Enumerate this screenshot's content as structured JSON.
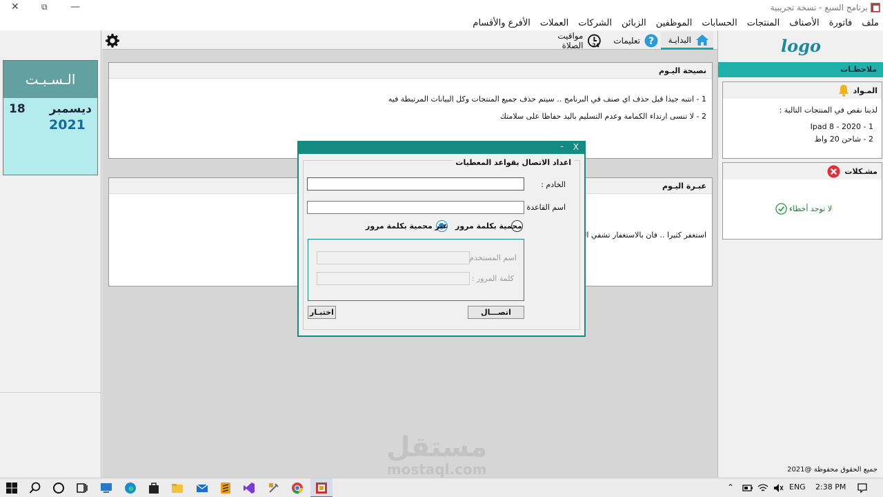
{
  "window": {
    "title": "برنامج السبع - نسخة تجريبية"
  },
  "menu": [
    "ملف",
    "فاتورة",
    "الأصناف",
    "المنتجات",
    "الحسابات",
    "الموظفين",
    "الزبائن",
    "الشركات",
    "العملات",
    "الأفرع والأقسام"
  ],
  "date": {
    "day": "الـسـبـت",
    "day_num": "18",
    "month": "ديسمبر",
    "year": "2021"
  },
  "tabs": {
    "home": "البدايـة",
    "help": "تعليمات",
    "prayer": "مواقيت الصلاة"
  },
  "tip": {
    "title": "نصيحة اليـوم",
    "line1": "1 - انتبه جيدا قبل حذف اي صنف في البرنامج  .. سيتم حذف جميع المنتجات وكل البيانات المرتبطة فيه",
    "line2": "2 - لا تنسى ارتداء الكمامة وعدم التسليم باليد حفاظا على سلامتك"
  },
  "quote": {
    "title": "عبـرة اليـوم",
    "text": "استغفر كثيرا .. فان بالاستغفار تشفي الهموم"
  },
  "logo": "logo",
  "notes": {
    "title": "ملاحظـات",
    "materials": {
      "title": "المـواد",
      "intro": "لدينا نقص في المنتجات التالية :",
      "item1": "1 - 2020 - Ipad 8",
      "item2": "2 - شاحن 20 واط"
    },
    "problems": {
      "title": "مشـكلات",
      "status": "لا توجد أخطاء"
    },
    "copyright": "جميع الحقوق محفوظة @2021"
  },
  "dialog": {
    "title": "X",
    "min": "-",
    "legend": "اعداد الاتصال بقواعد المعطيات",
    "server_label": "الخادم :",
    "server_value": "",
    "db_label": "اسم القاعدة :",
    "db_value": "",
    "radio_protected": "محمية بكلمة مرور",
    "radio_unprotected": "غير محمية بكلمة مرور",
    "user_label": "اسم المستخدم :",
    "pass_label": "كلمة المرور :",
    "connect": "اتصـــال",
    "test": "اختبـار"
  },
  "watermark": {
    "ar": "مستقل",
    "en": "mostaql.com"
  },
  "tray": {
    "lang": "ENG",
    "time": "2:38 PM"
  },
  "colors": {
    "teal": "#20b0aa",
    "dialog": "#138a82",
    "date_header": "#62a0a2",
    "date_bg": "#b4ecee"
  }
}
